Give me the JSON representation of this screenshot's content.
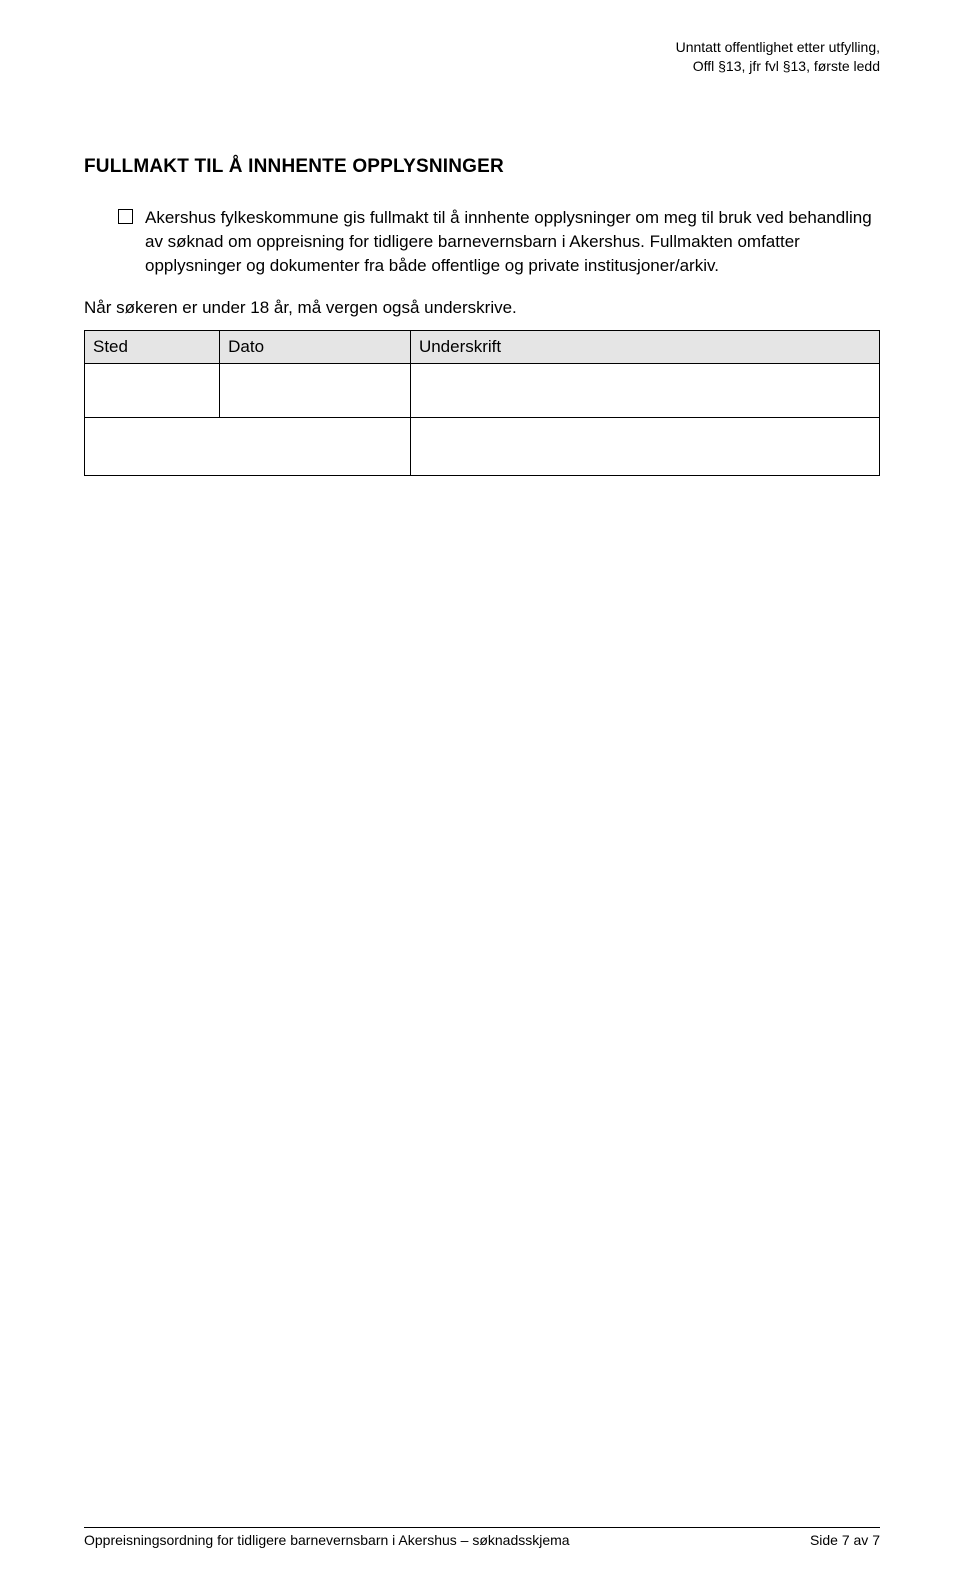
{
  "header": {
    "exempt_line1": "Unntatt offentlighet etter utfylling,",
    "exempt_line2": "Offl §13, jfr fvl §13, første ledd"
  },
  "title": "FULLMAKT TIL Å INNHENTE OPPLYSNINGER",
  "consent_text": "Akershus fylkeskommune gis fullmakt til å innhente opplysninger om meg til bruk ved behandling av søknad om oppreisning for tidligere barnevernsbarn i Akershus. Fullmakten omfatter opplysninger og dokumenter fra både offentlige og private institusjoner/arkiv.",
  "undersign_note": "Når søkeren er under 18 år, må vergen også underskrive.",
  "table": {
    "headers": {
      "sted": "Sted",
      "dato": "Dato",
      "underskrift": "Underskrift"
    }
  },
  "footer": {
    "left": "Oppreisningsordning for tidligere barnevernsbarn i Akershus – søknadsskjema",
    "right": "Side 7 av 7"
  }
}
